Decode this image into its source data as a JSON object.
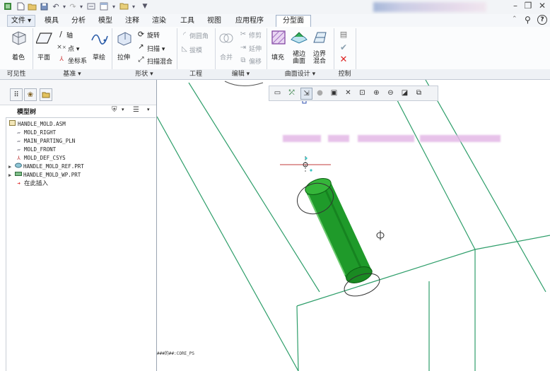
{
  "menu": {
    "tabs": [
      "文件",
      "模具",
      "分析",
      "模型",
      "注释",
      "渲染",
      "工具",
      "视图",
      "应用程序",
      "分型面"
    ],
    "active_tab": "分型面"
  },
  "ribbon": {
    "visibility": {
      "color_label": "着色"
    },
    "datum": {
      "plane": "平面",
      "axis": "轴",
      "point": "点",
      "csys": "坐标系",
      "sketch": "草绘"
    },
    "shapes": {
      "extrude": "拉伸",
      "revolve": "旋转",
      "sweep": "扫描",
      "swept_blend": "扫描混合"
    },
    "engineering": {
      "round": "倒圆角",
      "draft": "拔模"
    },
    "editing": {
      "merge": "合并",
      "trim": "修剪",
      "extend": "延伸",
      "offset": "偏移"
    },
    "surface_design": {
      "fill": "填充",
      "skirt": "裙边曲面",
      "boundary": "边界混合"
    },
    "groups": [
      "可见性",
      "基准",
      "形状",
      "工程",
      "编辑",
      "曲面设计",
      "控制"
    ]
  },
  "left_panel": {
    "title": "模型树",
    "tree": [
      {
        "label": "HANDLE_MOLD.ASM",
        "icon": "assembly-icon",
        "level": 0,
        "expandable": false
      },
      {
        "label": "MOLD_RIGHT",
        "icon": "datum-plane-icon",
        "level": 1,
        "expandable": false
      },
      {
        "label": "MAIN_PARTING_PLN",
        "icon": "datum-plane-icon",
        "level": 1,
        "expandable": false
      },
      {
        "label": "MOLD_FRONT",
        "icon": "datum-plane-icon",
        "level": 1,
        "expandable": false
      },
      {
        "label": "MOLD_DEF_CSYS",
        "icon": "csys-icon",
        "level": 1,
        "expandable": false
      },
      {
        "label": "HANDLE_MOLD_REF.PRT",
        "icon": "part-icon",
        "level": 0,
        "expandable": true
      },
      {
        "label": "HANDLE_MOLD_WP.PRT",
        "icon": "workpiece-icon",
        "level": 0,
        "expandable": true
      },
      {
        "label": "在此插入",
        "icon": "insert-here-icon",
        "level": 1,
        "expandable": false
      }
    ]
  },
  "graphics": {
    "coord_label": "###的##:CORE_PS",
    "colors": {
      "wireframe": "#2e9e6a",
      "cylinder": "#1f9a2a",
      "datum_red": "#c23b3b"
    }
  }
}
